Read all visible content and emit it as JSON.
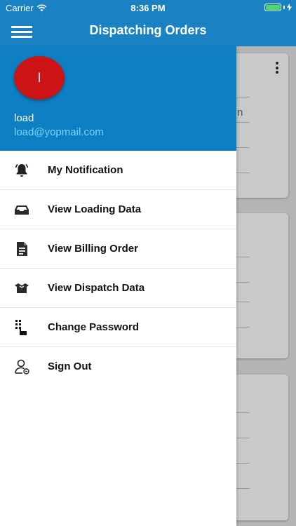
{
  "status_bar": {
    "carrier": "Carrier",
    "time": "8:36 PM",
    "battery_level": 1.0
  },
  "navbar": {
    "title": "Dispatching Orders",
    "menu_icon": "hamburger-icon"
  },
  "drawer": {
    "avatar_initial": "l",
    "user_name": "load",
    "user_email": "load@yopmail.com",
    "items": [
      {
        "label": "My Notification",
        "icon": "bell-icon"
      },
      {
        "label": "View Loading Data",
        "icon": "inbox-tray-icon"
      },
      {
        "label": "View Billing Order",
        "icon": "document-icon"
      },
      {
        "label": "View Dispatch Data",
        "icon": "open-box-icon"
      },
      {
        "label": "Change Password",
        "icon": "keypad-icon"
      },
      {
        "label": "Sign Out",
        "icon": "user-signout-icon"
      }
    ]
  },
  "background_card_partial_text": "n",
  "colors": {
    "header_blue": "#1a82c2",
    "drawer_header_blue": "#0e7fc3",
    "avatar_red": "#cc1417",
    "email_cyan": "#74d6f4",
    "battery_green": "#4cd964"
  }
}
